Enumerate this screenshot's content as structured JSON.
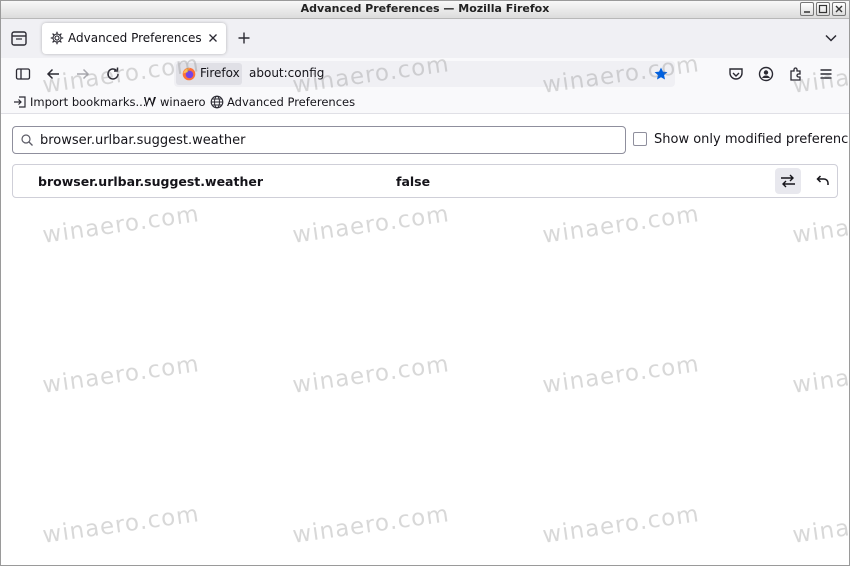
{
  "window": {
    "title": "Advanced Preferences — Mozilla Firefox"
  },
  "tabs": [
    {
      "label": "Advanced Preferences",
      "icon": "gear-icon",
      "active": true
    }
  ],
  "navbar": {
    "identity_label": "Firefox",
    "url": "about:config"
  },
  "bookmarks": [
    {
      "label": "Import bookmarks...",
      "icon": "import-icon"
    },
    {
      "label": "winaero",
      "icon": "winaero-logo-icon"
    },
    {
      "label": "Advanced Preferences",
      "icon": "globe-icon"
    }
  ],
  "config": {
    "search_value": "browser.urlbar.suggest.weather",
    "show_modified_label": "Show only modified preferences",
    "show_modified_checked": false,
    "preference": {
      "name": "browser.urlbar.suggest.weather",
      "value": "false"
    }
  },
  "watermark": {
    "text": "winaero.com"
  },
  "colors": {
    "star": "#0060df",
    "tab_bg": "#ffffff",
    "toolbar_bg": "#f9f9fb",
    "tabstrip_bg": "#f0f0f4"
  }
}
